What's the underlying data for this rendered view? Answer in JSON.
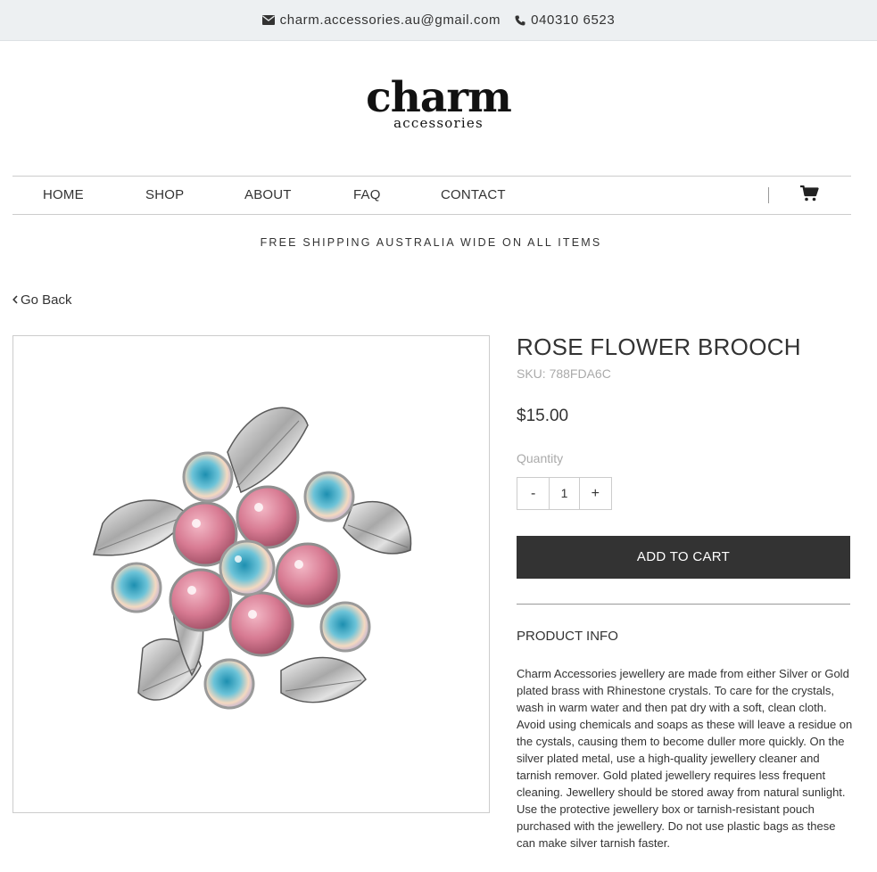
{
  "topbar": {
    "email": "charm.accessories.au@gmail.com",
    "phone": "040310 6523"
  },
  "logo": {
    "word": "charm",
    "sub": "accessories"
  },
  "nav": {
    "items": [
      "HOME",
      "SHOP",
      "ABOUT",
      "FAQ",
      "CONTACT"
    ]
  },
  "banner": "FREE SHIPPING AUSTRALIA WIDE ON ALL ITEMS",
  "go_back": "Go Back",
  "product": {
    "title": "ROSE FLOWER BROOCH",
    "sku": "SKU: 788FDA6C",
    "price": "$15.00",
    "quantity_label": "Quantity",
    "quantity": "1",
    "minus": "-",
    "plus": "+",
    "add_to_cart": "ADD TO CART",
    "info_title": "PRODUCT INFO",
    "info_text": "Charm Accessories jewellery are made from either Silver or Gold plated brass with Rhinestone crystals. To care for the crystals, wash in warm water and then pat dry with a soft, clean cloth. Avoid using chemicals and soaps as these will leave a residue on the cystals, causing them to become duller more quickly. On the silver plated metal, use a high-quality jewellery cleaner and tarnish remover. Gold plated jewellery requires less frequent cleaning. Jewellery should be stored away from natural sunlight. Use the protective jewellery box or tarnish-resistant pouch purchased with the jewellery. Do not use plastic bags as these can make silver tarnish faster."
  },
  "icons": {
    "email": "envelope-icon",
    "phone": "phone-icon",
    "cart": "cart-icon",
    "back": "chevron-left-icon"
  },
  "colors": {
    "topbar_bg": "#edf0f2",
    "button_bg": "#333333",
    "muted_text": "#aaaaaa"
  }
}
